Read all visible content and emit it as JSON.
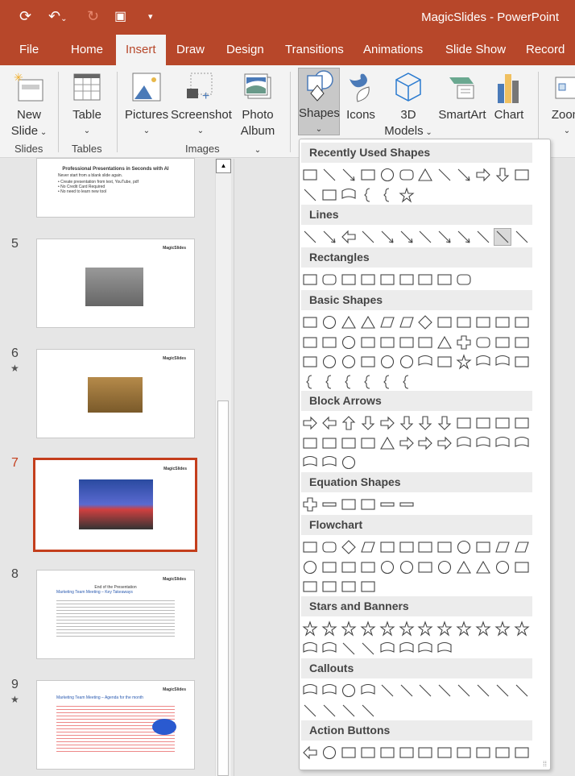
{
  "app": {
    "title": "MagicSlides  -  PowerPoint"
  },
  "tabs": [
    "File",
    "Home",
    "Insert",
    "Draw",
    "Design",
    "Transitions",
    "Animations",
    "Slide Show",
    "Record"
  ],
  "active_tab": "Insert",
  "ribbon": {
    "new_slide": [
      "New",
      "Slide"
    ],
    "table": "Table",
    "pictures": "Pictures",
    "screenshot": "Screenshot",
    "photo_album": [
      "Photo",
      "Album"
    ],
    "shapes": "Shapes",
    "icons": "Icons",
    "models": [
      "3D",
      "Models"
    ],
    "smartart": "SmartArt",
    "chart": "Chart",
    "zoom": "Zoom",
    "groups": {
      "slides": "Slides",
      "tables": "Tables",
      "images": "Images"
    }
  },
  "slides": [
    {
      "num": "5",
      "star": false
    },
    {
      "num": "6",
      "star": true
    },
    {
      "num": "7",
      "star": false,
      "selected": true
    },
    {
      "num": "8",
      "star": false,
      "title": "End of the Presentation",
      "line": "Marketing Team Meeting – Key Takeaways"
    },
    {
      "num": "9",
      "star": true,
      "line": "Marketing Team Meeting – Agenda for the month"
    }
  ],
  "slide4": {
    "title": "Professional Presentations in Seconds with AI",
    "sub": "Never start from a blank slide again.",
    "bullets": [
      "• Create presentation from text, YouTube, pdf",
      "• No Credit Card Required",
      "• No need to learn new tool"
    ]
  },
  "logo_text": "MagicSlides",
  "gallery": {
    "sections": [
      {
        "title": "Recently Used Shapes",
        "shapes": [
          "textbox",
          "line",
          "arrow",
          "rect",
          "oval",
          "rrect",
          "tri",
          "elbow",
          "elbowarrow",
          "rarrow",
          "darrow",
          "snip",
          "curve",
          "arc",
          "wave",
          "lbrace",
          "rbrace",
          "star"
        ]
      },
      {
        "title": "Lines",
        "shapes": [
          "line",
          "arrow",
          "dblarrow",
          "elbow",
          "elbowarrow",
          "elbowdbl",
          "curve",
          "curvearrow",
          "curvedbl",
          "freeform",
          "scribble-hl",
          "scribble"
        ]
      },
      {
        "title": "Rectangles",
        "shapes": [
          "rect",
          "rrect",
          "snip",
          "snip2",
          "snip3",
          "round1",
          "round2",
          "round3",
          "rrect"
        ]
      },
      {
        "title": "Basic Shapes",
        "shapes": [
          "textbox",
          "oval",
          "tri",
          "rtri",
          "para",
          "trap",
          "diamond",
          "penta",
          "hexa",
          "hepta",
          "octa",
          "deca",
          "dodeca",
          "pie",
          "chord",
          "tear",
          "frame",
          "halfframe",
          "lshape",
          "diagstripe",
          "cross",
          "plaque",
          "can",
          "cube",
          "bevel",
          "donut",
          "nosym",
          "blockarc",
          "foldcorner",
          "smiley",
          "heart",
          "lightning",
          "sun",
          "moon",
          "cloud",
          "arc",
          "dblbracket",
          "dblbrace",
          "lbracket",
          "rbracket",
          "lbrace",
          "rbrace"
        ]
      },
      {
        "title": "Block Arrows",
        "shapes": [
          "rarrow",
          "larrow",
          "uarrow",
          "darrow",
          "lrarrow",
          "udarrow",
          "quadarrow",
          "lrudarrow",
          "bentarrow",
          "uturn",
          "lupturn",
          "bentup",
          "ccw",
          "cw",
          "curvedup",
          "curveddown",
          "stripedarrow",
          "notched",
          "pentagon",
          "chevron",
          "rcallout",
          "dcallout",
          "lcallout",
          "ucallout",
          "lrcallout",
          "quadcallout",
          "circlearrow"
        ]
      },
      {
        "title": "Equation Shapes",
        "shapes": [
          "plus",
          "minus",
          "multiply",
          "divide",
          "equal",
          "notequal"
        ]
      },
      {
        "title": "Flowchart",
        "shapes": [
          "rect",
          "rrect",
          "diamond",
          "para",
          "predef",
          "internal",
          "doc",
          "multidoc",
          "terminator",
          "prep",
          "manual",
          "manualop",
          "oval",
          "offpage",
          "card",
          "tape",
          "sumjunc",
          "or",
          "collate",
          "sort",
          "extract",
          "merge",
          "stored",
          "delay",
          "seqaccess",
          "magdisk",
          "directaccess",
          "display"
        ]
      },
      {
        "title": "Stars and Banners",
        "shapes": [
          "explo1",
          "explo2",
          "star4",
          "star5",
          "star6",
          "star7",
          "star8",
          "star10",
          "star12",
          "star16",
          "star24",
          "star32",
          "ribbonup",
          "ribbondown",
          "curvedribbon",
          "curvedribbon2",
          "vscroll",
          "hscroll",
          "wave",
          "dblwave"
        ]
      },
      {
        "title": "Callouts",
        "shapes": [
          "rectcallout",
          "rrectcallout",
          "ovalcallout",
          "cloudcallout",
          "line1",
          "line2",
          "line3",
          "line1b",
          "line2b",
          "line3b",
          "line1c",
          "line2c",
          "line3c",
          "line1d",
          "line2d",
          "line3d"
        ]
      },
      {
        "title": "Action Buttons",
        "shapes": [
          "back",
          "forward",
          "begin",
          "end",
          "home",
          "info",
          "return",
          "movie",
          "document",
          "sound",
          "help",
          "custom"
        ]
      }
    ]
  }
}
